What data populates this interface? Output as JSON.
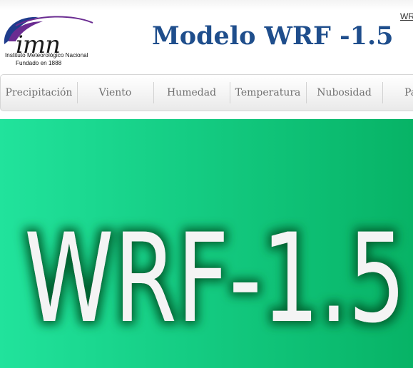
{
  "header": {
    "logo": {
      "wordmark": "imn",
      "org_name": "Instituto Meteorológico Nacional",
      "founded": "Fundado en 1888",
      "brand_blue": "#1f3c8c",
      "brand_purple": "#6a2c91"
    },
    "title": "Modelo WRF -1.5",
    "top_link": "WRF",
    "title_color": "#1f4e8c"
  },
  "nav": {
    "items": [
      {
        "label": "Precipitación"
      },
      {
        "label": "Viento"
      },
      {
        "label": "Humedad"
      },
      {
        "label": "Temperatura"
      },
      {
        "label": "Nubosidad"
      },
      {
        "label": "Pa"
      }
    ]
  },
  "hero": {
    "banner_text": "WRF-1.5",
    "bg_color": "#16cf86",
    "glow_color": "#035c2c"
  }
}
